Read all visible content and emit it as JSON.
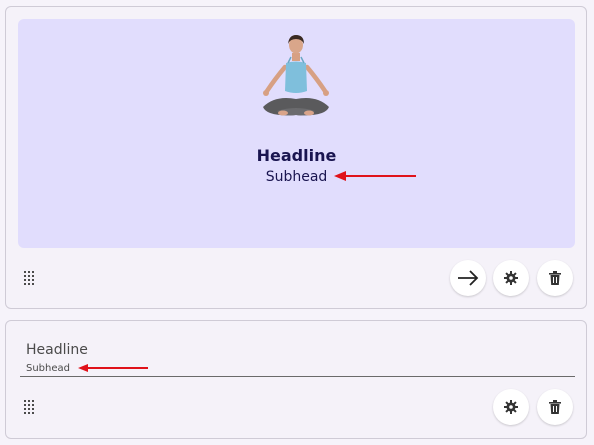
{
  "hero_card": {
    "headline": "Headline",
    "subhead": "Subhead",
    "image_icon": "meditating-person-photo",
    "actions": {
      "next_icon": "arrow-right-icon",
      "settings_icon": "gear-icon",
      "delete_icon": "trash-icon"
    },
    "drag_icon": "drag-handle-icon",
    "preview_background": "#e1ddfd"
  },
  "text_card": {
    "headline": "Headline",
    "subhead": "Subhead",
    "actions": {
      "settings_icon": "gear-icon",
      "delete_icon": "trash-icon"
    },
    "drag_icon": "drag-handle-icon"
  },
  "annotation_color": "#e0121a"
}
